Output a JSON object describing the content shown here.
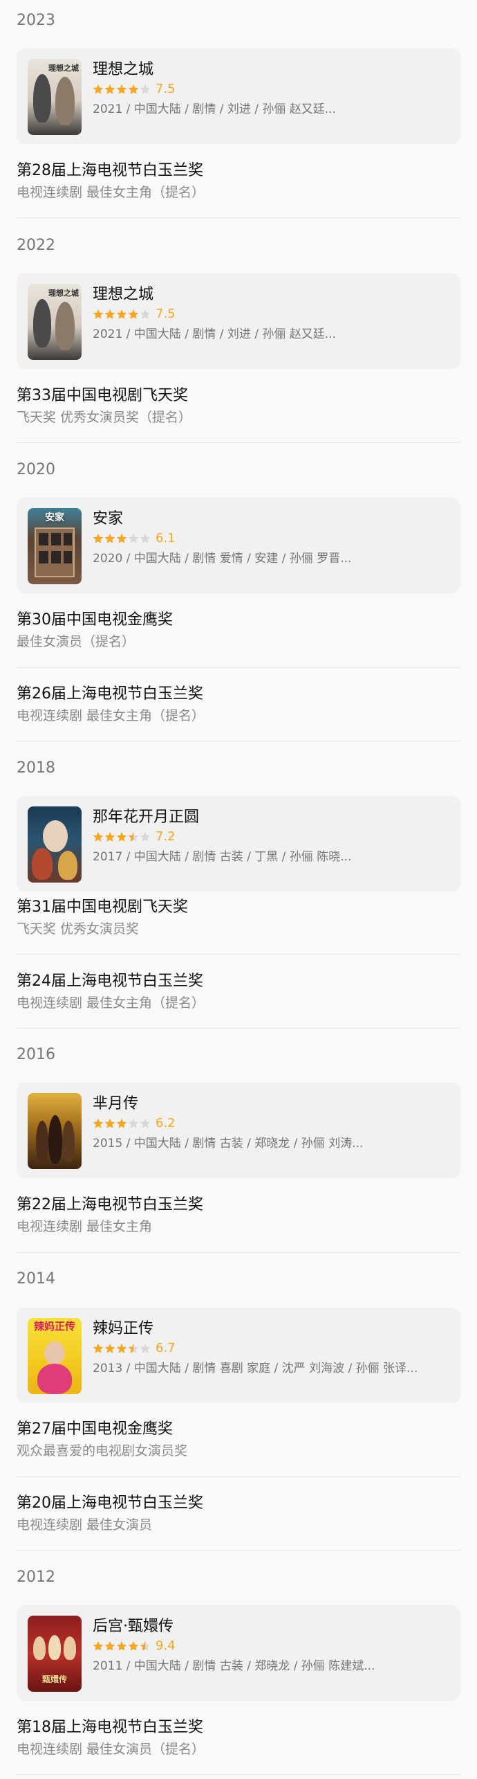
{
  "colors": {
    "star": "#f5a623",
    "star_empty": "#d8d8d8"
  },
  "years": [
    {
      "year": "2023",
      "movie": {
        "title": "理想之城",
        "rating": "7.5",
        "stars": 4,
        "meta": "2021 / 中国大陆 / 剧情 / 刘进 / 孙俪 赵又廷...",
        "poster_text": "理想之城"
      },
      "awards": [
        {
          "name": "第28届上海电视节白玉兰奖",
          "category": "电视连续剧 最佳女主角（提名）"
        }
      ]
    },
    {
      "year": "2022",
      "movie": {
        "title": "理想之城",
        "rating": "7.5",
        "stars": 4,
        "meta": "2021 / 中国大陆 / 剧情 / 刘进 / 孙俪 赵又廷...",
        "poster_text": "理想之城"
      },
      "awards": [
        {
          "name": "第33届中国电视剧飞天奖",
          "category": "飞天奖 优秀女演员奖（提名）"
        }
      ]
    },
    {
      "year": "2020",
      "movie": {
        "title": "安家",
        "rating": "6.1",
        "stars": 3,
        "meta": "2020 / 中国大陆 / 剧情 爱情 / 安建 / 孙俪 罗晋...",
        "poster_text": "安家"
      },
      "awards": [
        {
          "name": "第30届中国电视金鹰奖",
          "category": "最佳女演员（提名）"
        },
        {
          "name": "第26届上海电视节白玉兰奖",
          "category": "电视连续剧 最佳女主角（提名）"
        }
      ]
    },
    {
      "year": "2018",
      "movie": {
        "title": "那年花开月正圆",
        "rating": "7.2",
        "stars": 3.5,
        "meta": "2017 / 中国大陆 / 剧情 古装 / 丁黑 / 孙俪 陈晓...",
        "poster_text": ""
      },
      "awards": [
        {
          "name": "第31届中国电视剧飞天奖",
          "category": "飞天奖 优秀女演员奖"
        },
        {
          "name": "第24届上海电视节白玉兰奖",
          "category": "电视连续剧 最佳女主角（提名）"
        }
      ]
    },
    {
      "year": "2016",
      "movie": {
        "title": "芈月传",
        "rating": "6.2",
        "stars": 3,
        "meta": "2015 / 中国大陆 / 剧情 古装 / 郑晓龙 / 孙俪 刘涛...",
        "poster_text": ""
      },
      "awards": [
        {
          "name": "第22届上海电视节白玉兰奖",
          "category": "电视连续剧 最佳女主角"
        }
      ]
    },
    {
      "year": "2014",
      "movie": {
        "title": "辣妈正传",
        "rating": "6.7",
        "stars": 3.5,
        "meta": "2013 / 中国大陆 / 剧情 喜剧 家庭 / 沈严 刘海波 / 孙俪 张译...",
        "poster_text": "辣妈正传"
      },
      "awards": [
        {
          "name": "第27届中国电视金鹰奖",
          "category": "观众最喜爱的电视剧女演员奖"
        },
        {
          "name": "第20届上海电视节白玉兰奖",
          "category": "电视连续剧 最佳女演员"
        }
      ]
    },
    {
      "year": "2012",
      "movie": {
        "title": "后宫·甄嬛传",
        "rating": "9.4",
        "stars": 4.5,
        "meta": "2011 / 中国大陆 / 剧情 古装 / 郑晓龙 / 孙俪 陈建斌...",
        "poster_text": "甄嬛传"
      },
      "awards": [
        {
          "name": "第18届上海电视节白玉兰奖",
          "category": "电视连续剧 最佳女演员（提名）"
        }
      ]
    }
  ]
}
